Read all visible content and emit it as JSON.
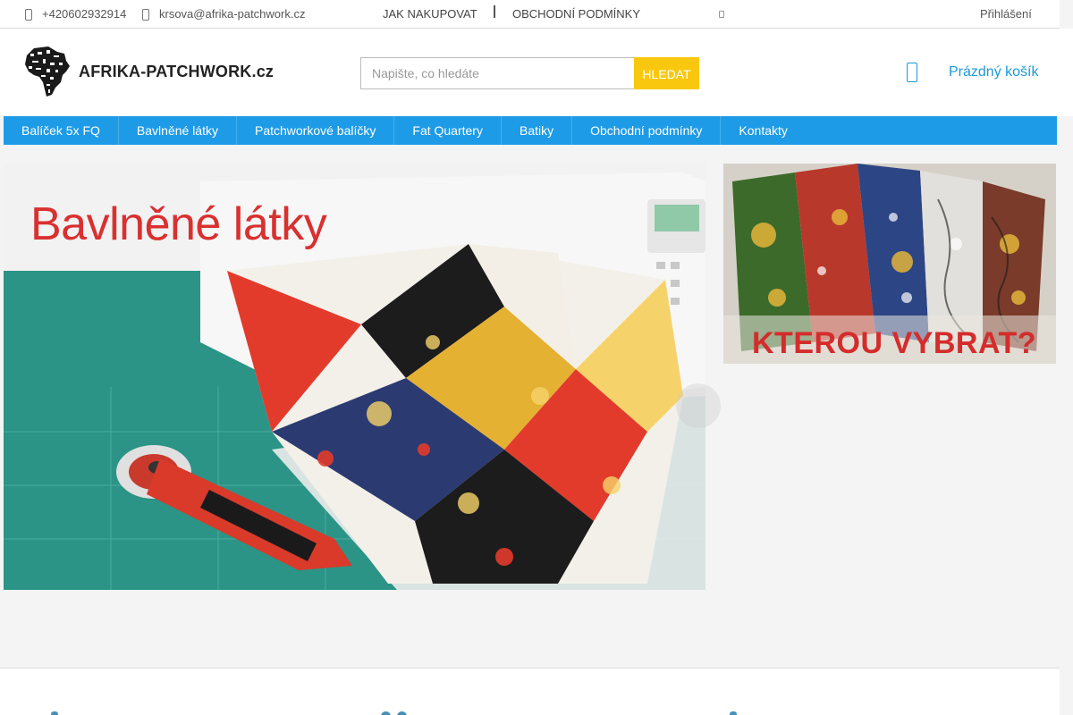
{
  "topbar": {
    "phone": "+420602932914",
    "email": "krsova@afrika-patchwork.cz",
    "links": [
      "JAK NAKUPOVAT",
      "OBCHODNÍ PODMÍNKY"
    ],
    "login": "Přihlášení"
  },
  "header": {
    "logo_text": "AFRIKA-PATCHWORK.cz",
    "search_placeholder": "Napište, co hledáte",
    "search_button": "HLEDAT",
    "cart_label": "Prázdný košík"
  },
  "nav": {
    "items": [
      "Balíček 5x FQ",
      "Bavlněné látky",
      "Patchworkové balíčky",
      "Fat Quartery",
      "Batiky",
      "Obchodní podmínky",
      "Kontakty"
    ]
  },
  "slider": {
    "title": "Bavlněné látky"
  },
  "banner": {
    "title": "KTEROU VYBRAT?"
  },
  "colors": {
    "nav_bg": "#1e9be6",
    "search_button_bg": "#f9c80e",
    "accent": "#1a99d8",
    "slide_title": "#d93030"
  },
  "icons": [
    "phone-icon",
    "mail-icon",
    "cart-icon",
    "next-arrow-icon"
  ]
}
